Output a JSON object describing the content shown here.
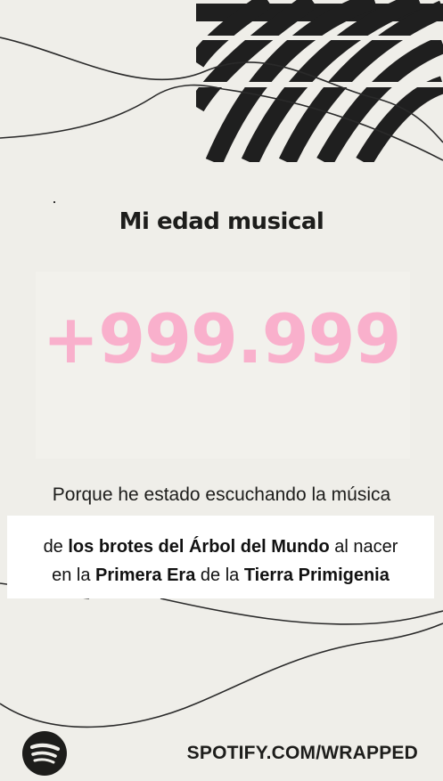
{
  "title": "Mi edad musical",
  "age": "+999.999",
  "reason_line": "Porque he estado escuchando la música",
  "detail": {
    "l1_pre": "de ",
    "l1_bold": "los brotes del Árbol del Mundo",
    "l1_post": " al nacer",
    "l2_pre": "en la ",
    "l2_bold1": "Primera Era",
    "l2_mid": " de la ",
    "l2_bold2": "Tierra Primigenia"
  },
  "footer": {
    "url": "SPOTIFY.COM/WRAPPED",
    "logo_icon": "spotify-logo-icon"
  },
  "colors": {
    "background": "#efeee9",
    "age_pink": "#f9b0cc",
    "text_dark": "#1d1d1b",
    "stripe_dark": "#1f1f1f"
  }
}
